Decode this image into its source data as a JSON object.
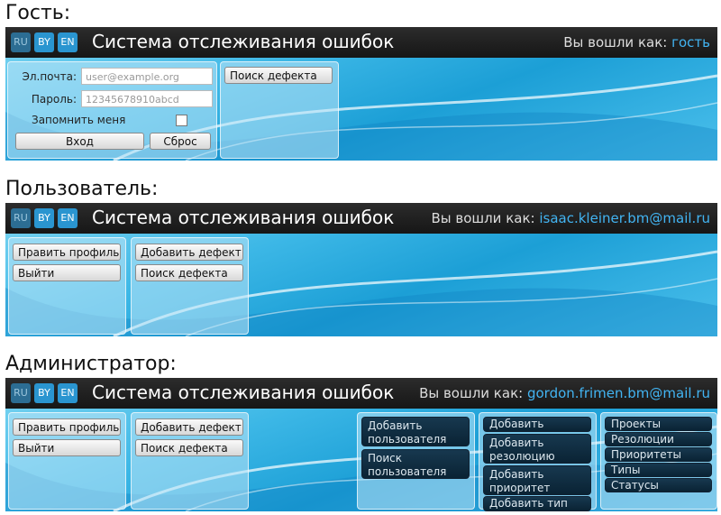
{
  "captions": {
    "guest": "Гость:",
    "user": "Пользователь:",
    "admin": "Администратор:"
  },
  "header": {
    "app_title": "Система отслеживания ошибок",
    "lang_ru": "RU",
    "lang_by": "BY",
    "lang_en": "EN",
    "logged_in_as": "Вы вошли как:"
  },
  "guest": {
    "who": "гость",
    "email_label": "Эл.почта:",
    "email_placeholder": "user@example.org",
    "password_label": "Пароль:",
    "password_placeholder": "12345678910abcd",
    "remember_label": "Запомнить меня",
    "login_button": "Вход",
    "reset_button": "Сброс",
    "search_bug": "Поиск дефекта"
  },
  "user": {
    "who": "isaac.kleiner.bm@mail.ru",
    "edit_profile": "Править профиль",
    "logout": "Выйти",
    "add_bug": "Добавить дефект",
    "search_bug": "Поиск дефекта"
  },
  "admin": {
    "who": "gordon.frimen.bm@mail.ru",
    "edit_profile": "Править профиль",
    "logout": "Выйти",
    "add_bug": "Добавить дефект",
    "search_bug": "Поиск дефекта",
    "add_user": "Добавить пользователя",
    "search_user": "Поиск пользователя",
    "add_project": "Добавить проект",
    "add_resolution": "Добавить резолюцию",
    "add_priority": "Добавить приоритет",
    "add_type": "Добавить тип",
    "projects": "Проекты",
    "resolutions": "Резолюции",
    "priorities": "Приоритеты",
    "types": "Типы",
    "statuses": "Статусы"
  },
  "colors": {
    "accent": "#42b4f2",
    "topbar": "#1c1c1c",
    "dark_button": "#0f2c40"
  }
}
